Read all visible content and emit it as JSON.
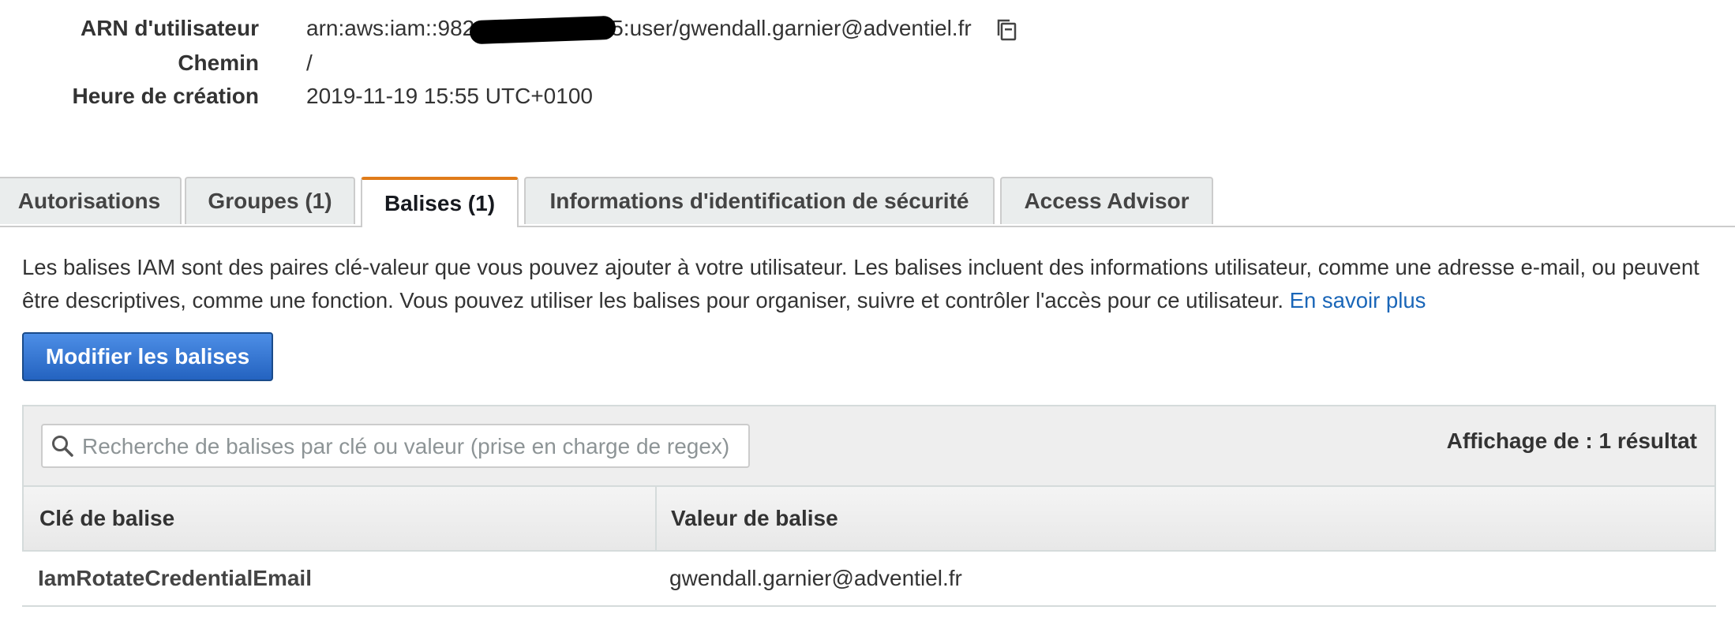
{
  "summary": {
    "arn_label": "ARN d'utilisateur",
    "arn_prefix": "arn:aws:iam::982",
    "arn_suffix": "5:user/gwendall.garnier@adventiel.fr",
    "path_label": "Chemin",
    "path_value": "/",
    "created_label": "Heure de création",
    "created_value": "2019-11-19 15:55 UTC+0100"
  },
  "tabs": [
    {
      "label": "Autorisations",
      "active": false
    },
    {
      "label": "Groupes (1)",
      "active": false
    },
    {
      "label": "Balises (1)",
      "active": true
    },
    {
      "label": "Informations d'identification de sécurité",
      "active": false
    },
    {
      "label": "Access Advisor",
      "active": false
    }
  ],
  "tags_tab": {
    "description": "Les balises IAM sont des paires clé-valeur que vous pouvez ajouter à votre utilisateur. Les balises incluent des informations utilisateur, comme une adresse e-mail, ou peuvent être descriptives, comme une fonction. Vous pouvez utiliser les balises pour organiser, suivre et contrôler l'accès pour ce utilisateur.",
    "learn_more": "En savoir plus",
    "edit_button": "Modifier les balises",
    "search_placeholder": "Recherche de balises par clé ou valeur (prise en charge de regex)",
    "result_count": "Affichage de : 1 résultat",
    "columns": {
      "key": "Clé de balise",
      "value": "Valeur de balise"
    },
    "rows": [
      {
        "key": "IamRotateCredentialEmail",
        "value": "gwendall.garnier@adventiel.fr"
      }
    ]
  },
  "colors": {
    "accent_tab": "#e07b19",
    "primary_button": "#2463c0",
    "link": "#1a66b8"
  },
  "icons": {
    "copy": "copy-icon",
    "search": "search-icon"
  }
}
